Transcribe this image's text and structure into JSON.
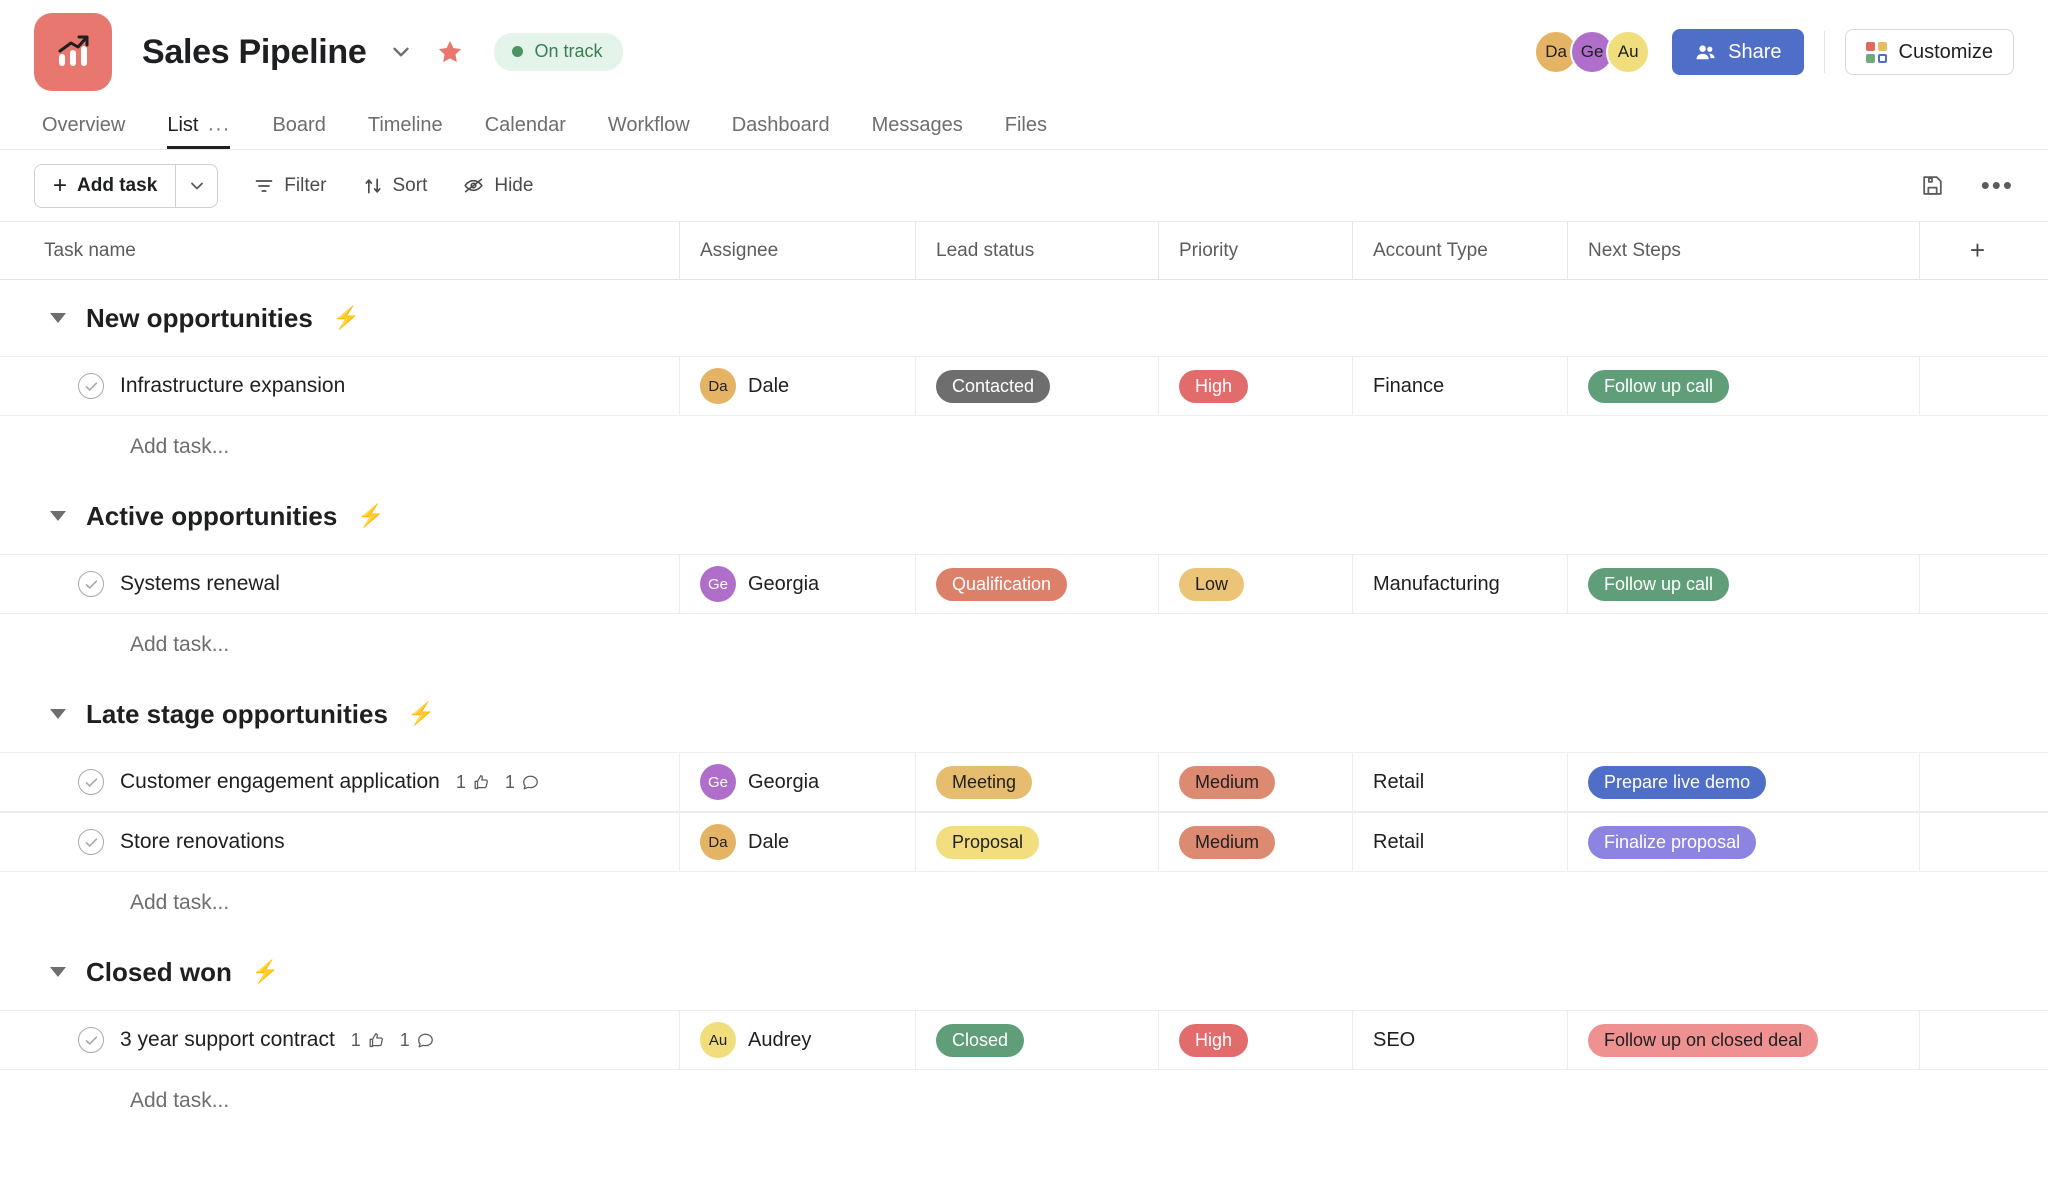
{
  "header": {
    "project_icon": "chart-trending-up-icon",
    "project_icon_color": "#e8786f",
    "title": "Sales Pipeline",
    "caret_icon": "chevron-down-icon",
    "star_icon": "star-icon",
    "star_color": "#e8786f",
    "status": "On track",
    "status_color": "#3b7d53",
    "avatars": [
      {
        "initials": "Da",
        "color": "#e4b363"
      },
      {
        "initials": "Ge",
        "color": "#b06ecb"
      },
      {
        "initials": "Au",
        "color": "#f0dd7c"
      }
    ],
    "share_label": "Share",
    "share_icon": "people-icon",
    "share_color": "#4f6ec8",
    "customize_label": "Customize",
    "customize_icon": "grid-squares-icon"
  },
  "tabs": [
    {
      "label": "Overview",
      "active": false
    },
    {
      "label": "List",
      "active": true,
      "overflow": "···"
    },
    {
      "label": "Board",
      "active": false
    },
    {
      "label": "Timeline",
      "active": false
    },
    {
      "label": "Calendar",
      "active": false
    },
    {
      "label": "Workflow",
      "active": false
    },
    {
      "label": "Dashboard",
      "active": false
    },
    {
      "label": "Messages",
      "active": false
    },
    {
      "label": "Files",
      "active": false
    }
  ],
  "toolbar": {
    "add_task_label": "Add task",
    "add_task_plus": "+",
    "add_task_caret": "chevron-down-icon",
    "filter_label": "Filter",
    "filter_icon": "filter-icon",
    "sort_label": "Sort",
    "sort_icon": "sort-arrows-icon",
    "hide_label": "Hide",
    "hide_icon": "eye-slash-icon",
    "save_icon": "floppy-disk-icon",
    "more_icon": "ellipsis-icon",
    "more_glyph": "•••"
  },
  "table": {
    "columns": [
      "Task name",
      "Assignee",
      "Lead status",
      "Priority",
      "Account Type",
      "Next Steps"
    ],
    "add_column_glyph": "+",
    "add_task_placeholder": "Add task...",
    "sections": [
      {
        "title": "New opportunities",
        "bolt": "⚡",
        "tasks": [
          {
            "name": "Infrastructure expansion",
            "likes": "",
            "comments": "",
            "assignee": "Dale",
            "assignee_initials": "Da",
            "assignee_color": "#e4b363",
            "lead_status": "Contacted",
            "lead_status_bg": "#6e6e6e",
            "lead_status_fg": "#ffffff",
            "priority": "High",
            "priority_bg": "#e26b6b",
            "priority_fg": "#ffffff",
            "account_type": "Finance",
            "next_steps": "Follow up call",
            "next_steps_bg": "#5f9e78",
            "next_steps_fg": "#ffffff"
          }
        ]
      },
      {
        "title": "Active opportunities",
        "bolt": "⚡",
        "tasks": [
          {
            "name": "Systems renewal",
            "likes": "",
            "comments": "",
            "assignee": "Georgia",
            "assignee_initials": "Ge",
            "assignee_color": "#b06ecb",
            "lead_status": "Qualification",
            "lead_status_bg": "#dd8069",
            "lead_status_fg": "#ffffff",
            "priority": "Low",
            "priority_bg": "#ecc477",
            "priority_fg": "#1e1f21",
            "account_type": "Manufacturing",
            "next_steps": "Follow up call",
            "next_steps_bg": "#5f9e78",
            "next_steps_fg": "#ffffff"
          }
        ]
      },
      {
        "title": "Late stage opportunities",
        "bolt": "⚡",
        "tasks": [
          {
            "name": "Customer engagement application",
            "likes": "1",
            "comments": "1",
            "assignee": "Georgia",
            "assignee_initials": "Ge",
            "assignee_color": "#b06ecb",
            "lead_status": "Meeting",
            "lead_status_bg": "#e6bc6e",
            "lead_status_fg": "#1e1f21",
            "priority": "Medium",
            "priority_bg": "#dd8a72",
            "priority_fg": "#1e1f21",
            "account_type": "Retail",
            "next_steps": "Prepare live demo",
            "next_steps_bg": "#4f6ec8",
            "next_steps_fg": "#ffffff"
          },
          {
            "name": "Store renovations",
            "likes": "",
            "comments": "",
            "assignee": "Dale",
            "assignee_initials": "Da",
            "assignee_color": "#e4b363",
            "lead_status": "Proposal",
            "lead_status_bg": "#f2de7e",
            "lead_status_fg": "#1e1f21",
            "priority": "Medium",
            "priority_bg": "#dd8a72",
            "priority_fg": "#1e1f21",
            "account_type": "Retail",
            "next_steps": "Finalize proposal",
            "next_steps_bg": "#8c84e0",
            "next_steps_fg": "#ffffff"
          }
        ]
      },
      {
        "title": "Closed won",
        "bolt": "⚡",
        "tasks": [
          {
            "name": "3 year support contract",
            "likes": "1",
            "comments": "1",
            "assignee": "Audrey",
            "assignee_initials": "Au",
            "assignee_color": "#f0dd7c",
            "lead_status": "Closed",
            "lead_status_bg": "#5f9e78",
            "lead_status_fg": "#ffffff",
            "priority": "High",
            "priority_bg": "#e26b6b",
            "priority_fg": "#ffffff",
            "account_type": "SEO",
            "next_steps": "Follow up on closed deal",
            "next_steps_bg": "#ef9191",
            "next_steps_fg": "#1e1f21"
          }
        ]
      }
    ]
  }
}
